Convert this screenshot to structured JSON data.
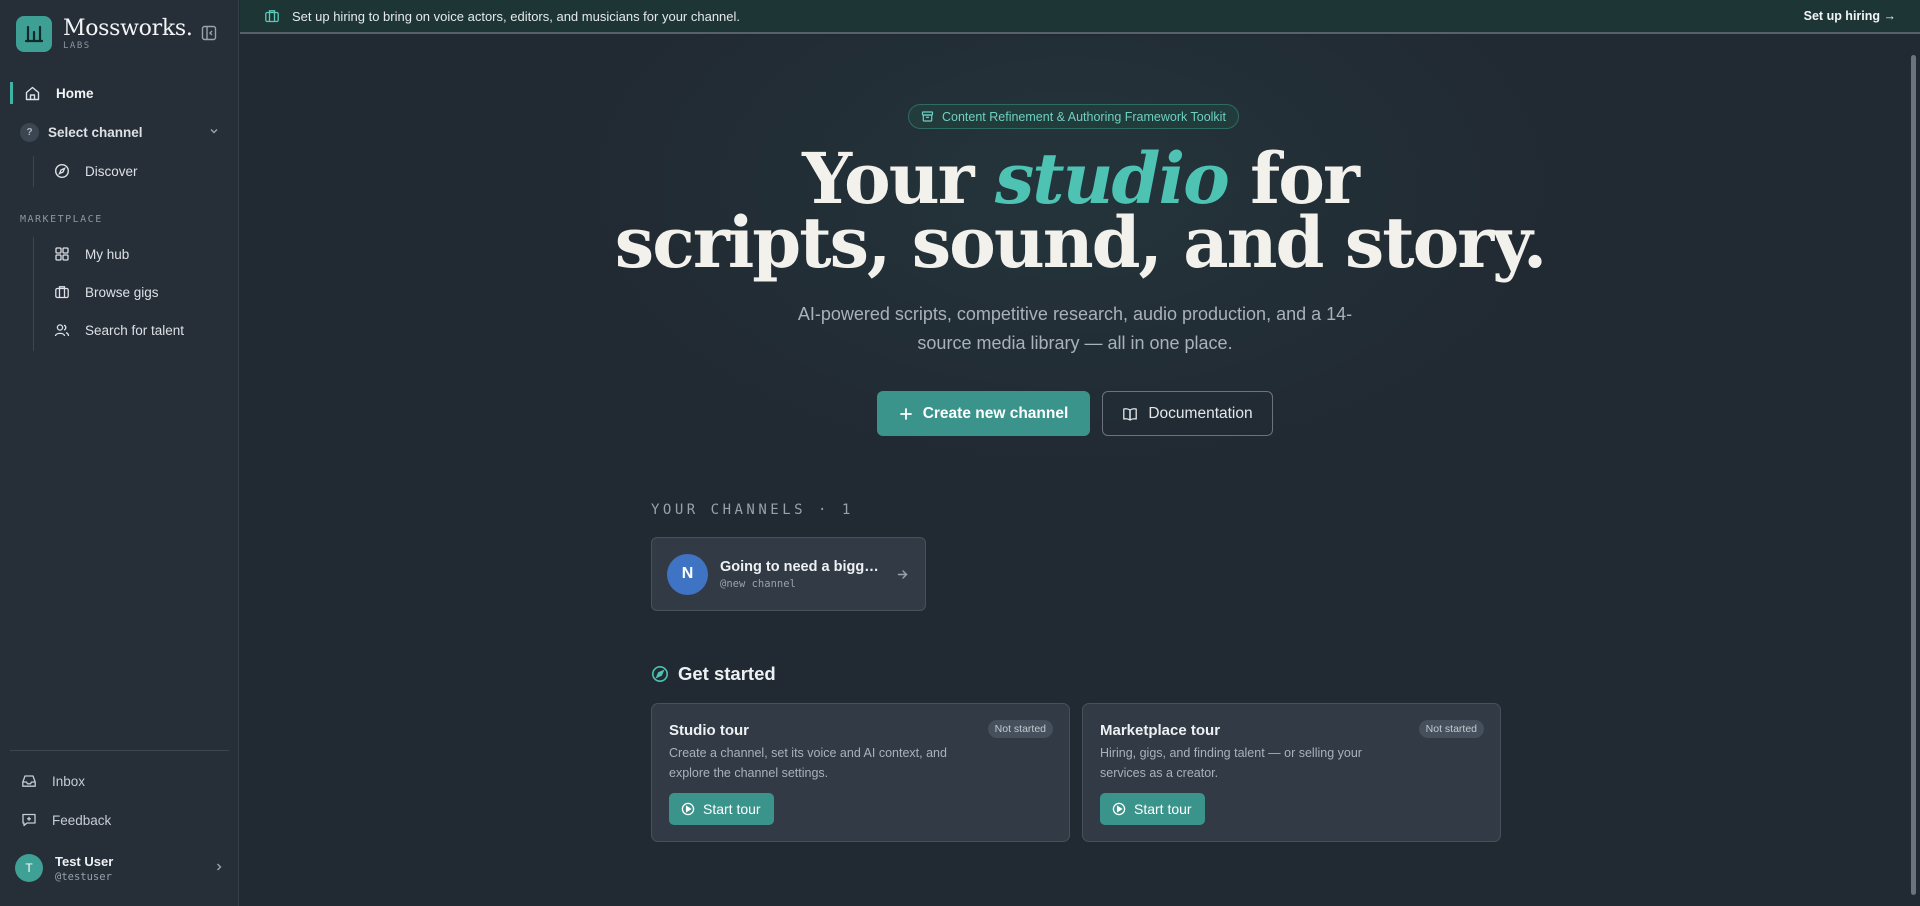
{
  "brand": {
    "name": "Mossworks.",
    "subtitle": "LABS"
  },
  "sidebar": {
    "home_label": "Home",
    "channel_select_label": "Select channel",
    "channel_select_badge": "?",
    "discover_label": "Discover",
    "marketplace_label": "MARKETPLACE",
    "marketplace_items": [
      "My hub",
      "Browse gigs",
      "Search for talent"
    ],
    "inbox_label": "Inbox",
    "feedback_label": "Feedback",
    "user": {
      "initial": "T",
      "name": "Test User",
      "handle": "@testuser"
    }
  },
  "banner": {
    "text": "Set up hiring to bring on voice actors, editors, and musicians for your channel.",
    "link": "Set up hiring →"
  },
  "hero": {
    "pill": "Content Refinement & Authoring Framework Toolkit",
    "title_pre": "Your ",
    "title_accent": "studio",
    "title_post": " for",
    "title_line2": "scripts, sound, and story.",
    "subtitle": "AI-powered scripts, competitive research, audio production, and a 14-source media library — all in one place.",
    "primary_button": "Create new channel",
    "secondary_button": "Documentation"
  },
  "channels": {
    "heading": "YOUR CHANNELS · 1",
    "items": [
      {
        "initial": "N",
        "name": "Going to need a bigger ...",
        "handle": "@new channel"
      }
    ]
  },
  "get_started": {
    "heading": "Get started",
    "tours": [
      {
        "title": "Studio tour",
        "status": "Not started",
        "description": "Create a channel, set its voice and AI context, and explore the channel settings.",
        "button": "Start tour"
      },
      {
        "title": "Marketplace tour",
        "status": "Not started",
        "description": "Hiring, gigs, and finding talent — or selling your services as a creator.",
        "button": "Start tour"
      }
    ]
  },
  "colors": {
    "accent": "#3a948b",
    "accent_text": "#4ec3b3",
    "background": "#212932",
    "sidebar": "#262e37"
  }
}
